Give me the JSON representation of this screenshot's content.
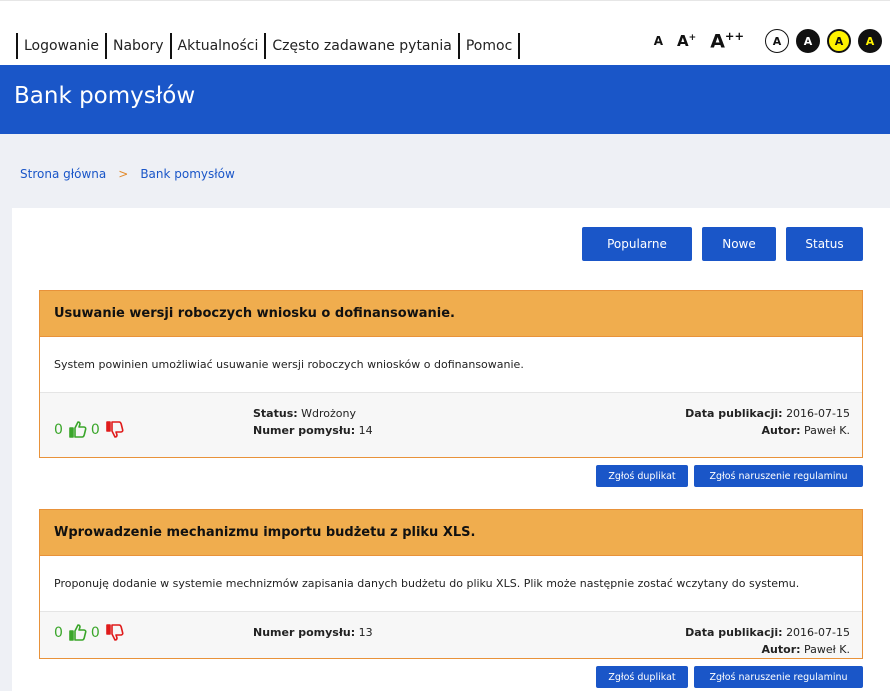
{
  "nav": {
    "items": [
      "Logowanie",
      "Nabory",
      "Aktualności",
      "Często zadawane pytania",
      "Pomoc"
    ]
  },
  "accessibility": {
    "font_small": "A",
    "font_medium": "A",
    "font_medium_sup": "+",
    "font_large": "A",
    "font_large_sup": "++",
    "contrast": [
      "A",
      "A",
      "A",
      "A"
    ]
  },
  "header": {
    "title": "Bank pomysłów"
  },
  "breadcrumb": {
    "home": "Strona główna",
    "separator": ">",
    "current": "Bank pomysłów"
  },
  "filters": {
    "popular": "Popularne",
    "new": "Nowe",
    "status": "Status"
  },
  "ideas": [
    {
      "title": "Usuwanie wersji roboczych wniosku o dofinansowanie.",
      "description": "System powinien umożliwiać usuwanie wersji roboczych wniosków o dofinansowanie.",
      "likes": "0",
      "dislikes": "0",
      "status_label": "Status:",
      "status": "Wdrożony",
      "number_label": "Numer pomysłu:",
      "number": "14",
      "date_label": "Data publikacji:",
      "date": "2016-07-15",
      "author_label": "Autor:",
      "author": "Paweł K.",
      "duplicate_button": "Zgłoś duplikat",
      "report_button": "Zgłoś naruszenie regulaminu"
    },
    {
      "title": "Wprowadzenie mechanizmu importu budżetu z pliku XLS.",
      "description": "Proponuję dodanie w systemie mechnizmów zapisania danych budżetu do pliku XLS. Plik może następnie zostać wczytany do systemu.",
      "likes": "0",
      "dislikes": "0",
      "number_label": "Numer pomysłu:",
      "number": "13",
      "date_label": "Data publikacji:",
      "date": "2016-07-15",
      "author_label": "Autor:",
      "author": "Paweł K.",
      "duplicate_button": "Zgłoś duplikat",
      "report_button": "Zgłoś naruszenie regulaminu"
    }
  ],
  "colors": {
    "primary": "#1a56c8",
    "card_header": "#f0ad4e",
    "card_border": "#e8923a",
    "like": "#3aa62a",
    "dislike": "#e01b1b"
  },
  "icons": {
    "like": "thumbs-up-icon",
    "dislike": "thumbs-down-icon"
  }
}
